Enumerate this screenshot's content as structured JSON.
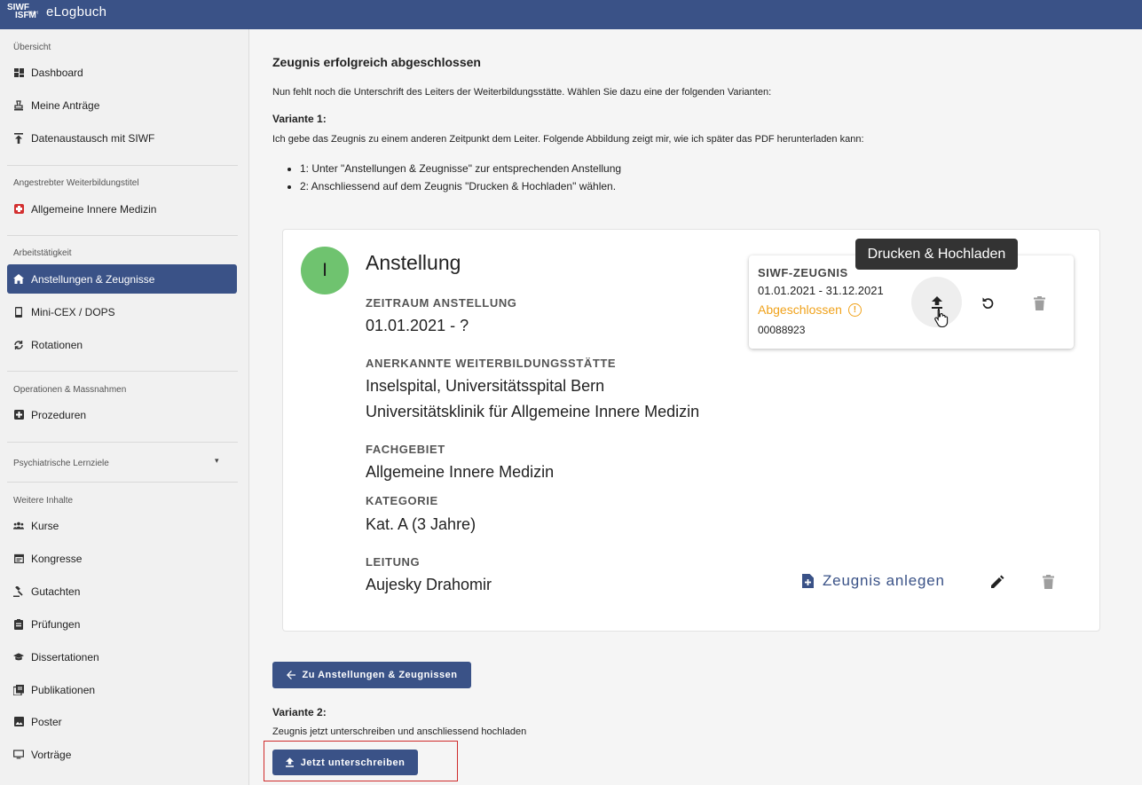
{
  "header": {
    "logo_line1": "SIWF",
    "logo_line2": "ISFM",
    "logo_small": "FMH",
    "app_title": "eLogbuch",
    "bg_color": "#3a5287"
  },
  "sidebar": {
    "sections": {
      "overview": "Übersicht",
      "target_title": "Angestrebter Weiterbildungstitel",
      "work": "Arbeitstätigkeit",
      "operations": "Operationen & Massnahmen",
      "psych": "Psychiatrische Lernziele",
      "further": "Weitere Inhalte"
    },
    "items": {
      "dashboard": "Dashboard",
      "antraege": "Meine Anträge",
      "datenaustausch": "Datenaustausch mit SIWF",
      "innere": "Allgemeine Innere Medizin",
      "anstellungen": "Anstellungen & Zeugnisse",
      "minicex": "Mini-CEX / DOPS",
      "rotationen": "Rotationen",
      "prozeduren": "Prozeduren",
      "kurse": "Kurse",
      "kongresse": "Kongresse",
      "gutachten": "Gutachten",
      "pruefungen": "Prüfungen",
      "dissertationen": "Dissertationen",
      "publikationen": "Publikationen",
      "poster": "Poster",
      "vortraege": "Vorträge"
    }
  },
  "main": {
    "title": "Zeugnis erfolgreich abgeschlossen",
    "intro": "Nun fehlt noch die Unterschrift des Leiters der Weiterbildungsstätte. Wählen Sie dazu eine der folgenden Varianten:",
    "variant1_title": "Variante 1:",
    "variant1_text": "Ich gebe das Zeugnis zu einem anderen Zeitpunkt dem Leiter. Folgende Abbildung zeigt mir, wie ich später das PDF herunterladen kann:",
    "steps": [
      "1: Unter \"Anstellungen & Zeugnisse\" zur entsprechenden Anstellung",
      "2: Anschliessend auf dem Zeugnis \"Drucken & Hochladen\" wählen."
    ],
    "back_button": "Zu Anstellungen & Zeugnissen",
    "variant2_title": "Variante 2:",
    "variant2_text": "Zeugnis jetzt unterschreiben und anschliessend hochladen",
    "sign_button": "Jetzt unterschreiben"
  },
  "card": {
    "avatar_letter": "I",
    "avatar_color": "#6fc36f",
    "title": "Anstellung",
    "zeitraum_label": "ZEITRAUM ANSTELLUNG",
    "zeitraum_value": "01.01.2021 - ?",
    "wbs_label": "ANERKANNTE WEITERBILDUNGSSTÄTTE",
    "wbs_line1": "Inselspital, Universitätsspital Bern",
    "wbs_line2": "Universitätsklinik für Allgemeine Innere Medizin",
    "fach_label": "FACHGEBIET",
    "fach_value": "Allgemeine Innere Medizin",
    "kat_label": "KATEGORIE",
    "kat_value": "Kat. A (3 Jahre)",
    "leitung_label": "LEITUNG",
    "leitung_value": "Aujesky Drahomir",
    "zeugnis_link": "Zeugnis anlegen"
  },
  "zeugnis": {
    "title": "SIWF-ZEUGNIS",
    "range": "01.01.2021 - 31.12.2021",
    "status": "Abgeschlossen",
    "status_color": "#f0a21b",
    "number": "00088923",
    "tooltip": "Drucken & Hochladen"
  }
}
